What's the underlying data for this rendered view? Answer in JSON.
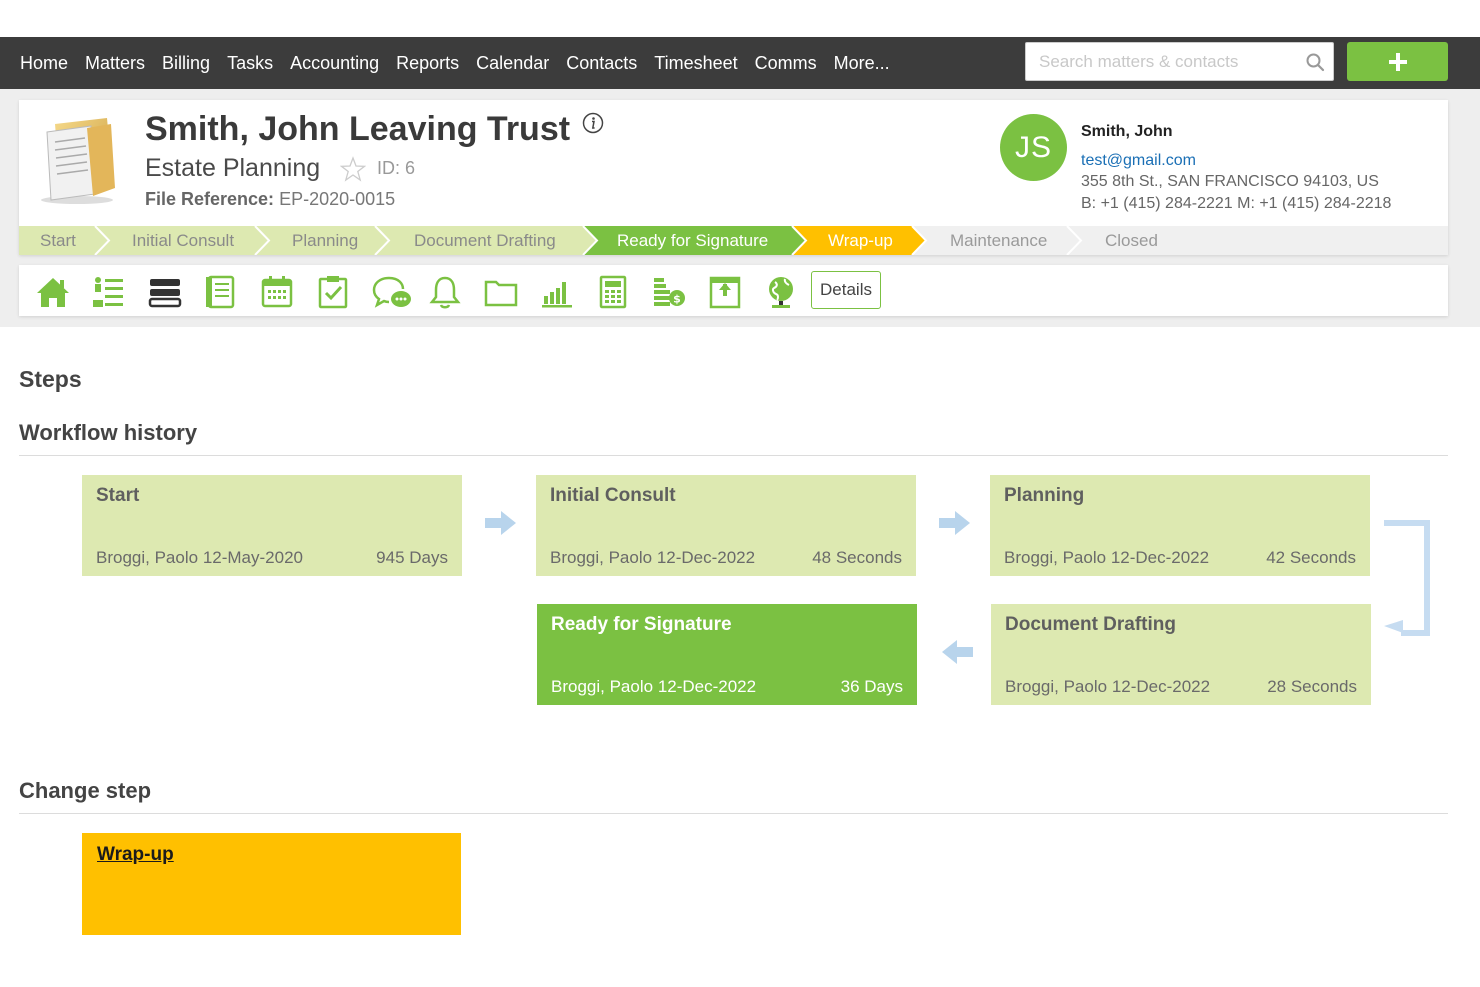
{
  "nav": {
    "items": [
      "Home",
      "Matters",
      "Billing",
      "Tasks",
      "Accounting",
      "Reports",
      "Calendar",
      "Contacts",
      "Timesheet",
      "Comms",
      "More..."
    ],
    "search_placeholder": "Search matters & contacts",
    "add_icon": "plus-icon",
    "bg_color": "#3c3c3c",
    "accent": "#7bc142"
  },
  "matter": {
    "title": "Smith, John Leaving Trust",
    "type": "Estate Planning",
    "id_label": "ID: 6",
    "file_ref_label": "File Reference:",
    "file_ref_value": " EP-2020-0015"
  },
  "contact": {
    "initials": "JS",
    "name": "Smith, John",
    "email": "test@gmail.com",
    "address": "355 8th St., SAN FRANCISCO 94103, US",
    "phone": "B: +1 (415) 284-2221  M: +1 (415) 284-2218"
  },
  "stages": [
    {
      "label": "Start",
      "state": "done"
    },
    {
      "label": "Initial Consult",
      "state": "done"
    },
    {
      "label": "Planning",
      "state": "done"
    },
    {
      "label": "Document Drafting",
      "state": "done"
    },
    {
      "label": "Ready for Signature",
      "state": "current"
    },
    {
      "label": "Wrap-up",
      "state": "next"
    },
    {
      "label": "Maintenance",
      "state": "todo"
    },
    {
      "label": "Closed",
      "state": "todo"
    }
  ],
  "stage_colors": {
    "done": "#dde9b1",
    "current": "#7bc142",
    "next": "#ffc000",
    "todo": "#f0f0f0"
  },
  "toolbar": {
    "icons": [
      "home-icon",
      "list-icon",
      "stack-icon",
      "notes-icon",
      "calendar-icon",
      "task-check-icon",
      "chat-icon",
      "bell-icon",
      "folder-icon",
      "bar-chart-icon",
      "calculator-icon",
      "billing-coins-icon",
      "export-icon",
      "globe-icon"
    ],
    "details_label": "Details"
  },
  "steps_title": "Steps",
  "workflow": {
    "title": "Workflow history",
    "entries": [
      {
        "name": "Start",
        "user": "Broggi, Paolo",
        "date": "12-May-2020",
        "duration": "945 Days"
      },
      {
        "name": "Initial Consult",
        "user": "Broggi, Paolo",
        "date": "12-Dec-2022",
        "duration": "48 Seconds"
      },
      {
        "name": "Planning",
        "user": "Broggi, Paolo",
        "date": "12-Dec-2022",
        "duration": "42 Seconds"
      },
      {
        "name": "Document Drafting",
        "user": "Broggi, Paolo",
        "date": "12-Dec-2022",
        "duration": "28 Seconds"
      },
      {
        "name": "Ready for Signature",
        "user": "Broggi, Paolo",
        "date": "12-Dec-2022",
        "duration": "36 Days"
      }
    ]
  },
  "change_step": {
    "title": "Change step",
    "option": "Wrap-up"
  }
}
